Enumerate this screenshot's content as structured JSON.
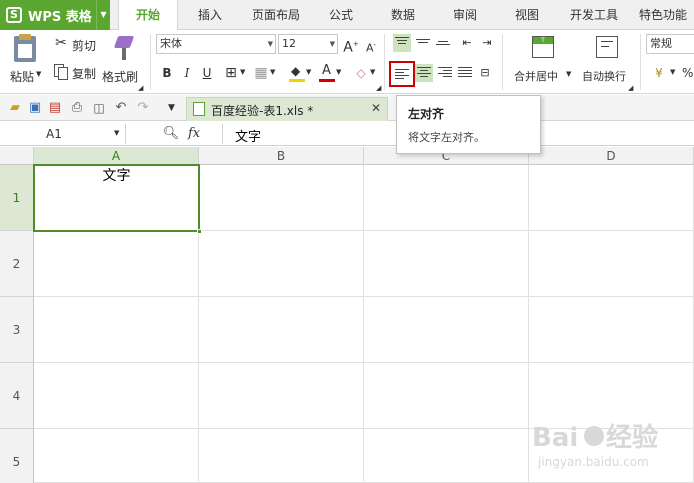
{
  "app": {
    "name": "WPS 表格",
    "logo_letter": "S"
  },
  "menu": {
    "tabs": [
      "开始",
      "插入",
      "页面布局",
      "公式",
      "数据",
      "审阅",
      "视图",
      "开发工具",
      "特色功能"
    ],
    "active_tab": "开始"
  },
  "ribbon": {
    "clipboard": {
      "paste": "粘贴",
      "cut": "剪切",
      "copy": "复制",
      "format_painter": "格式刷"
    },
    "font": {
      "name": "宋体",
      "size": "12",
      "bold": "B",
      "italic": "I",
      "underline": "U",
      "font_color_letter": "A"
    },
    "merge_center": "合并居中",
    "wrap_text": "自动换行",
    "number_format": "常规",
    "percent": "%"
  },
  "document_tab": {
    "title": "百度经验-表1.xls *"
  },
  "formula_bar": {
    "name_box": "A1",
    "fx": "fx",
    "content": "文字"
  },
  "grid": {
    "columns": [
      "A",
      "B",
      "C",
      "D"
    ],
    "rows": [
      "1",
      "2",
      "3",
      "4",
      "5"
    ],
    "selected_cell": "A1",
    "cell_a1_value": "文字"
  },
  "tooltip": {
    "title": "左对齐",
    "description": "将文字左对齐。"
  },
  "colors": {
    "brand_green": "#5ba531",
    "selection_green": "#4f8a2c",
    "highlight_red": "#cc0000"
  }
}
